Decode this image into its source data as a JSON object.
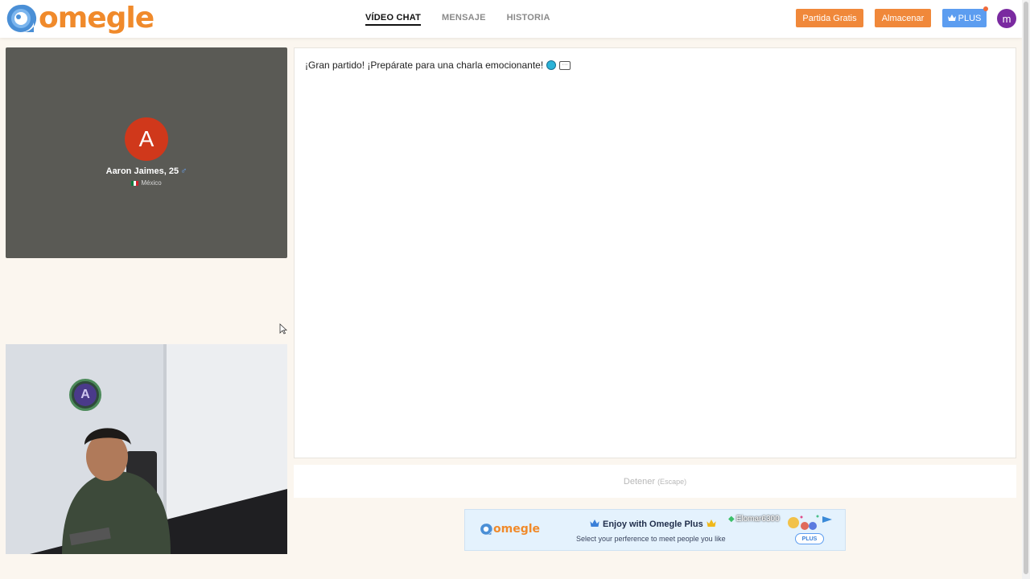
{
  "header": {
    "logo_text": "omegle",
    "nav": [
      {
        "label": "VÍDEO CHAT",
        "active": true
      },
      {
        "label": "MENSAJE",
        "active": false
      },
      {
        "label": "HISTORIA",
        "active": false
      }
    ],
    "buttons": {
      "free_match": "Partida Gratis",
      "store": "Almacenar",
      "plus": "PLUS"
    },
    "avatar_letter": "m",
    "colors": {
      "accent": "#f08a2b",
      "plus": "#5c9df0",
      "avatar": "#7a2aa0"
    }
  },
  "stranger": {
    "avatar_letter": "A",
    "name": "Aaron Jaimes, 25",
    "gender_icon": "male-icon",
    "location": "México",
    "avatar_color": "#d0381b"
  },
  "self_cam": {
    "badge_letter": "A"
  },
  "chat": {
    "message": "¡Gran partido! ¡Prepárate para una charla emocionante!"
  },
  "stop": {
    "label": "Detener",
    "key_hint": "(Escape)"
  },
  "banner": {
    "logo_text": "omegle",
    "title": "Enjoy with Omegle Plus",
    "subtitle": "Select your perference to meet people you like",
    "user": "Elomar6300",
    "plus_label": "PLUS"
  }
}
